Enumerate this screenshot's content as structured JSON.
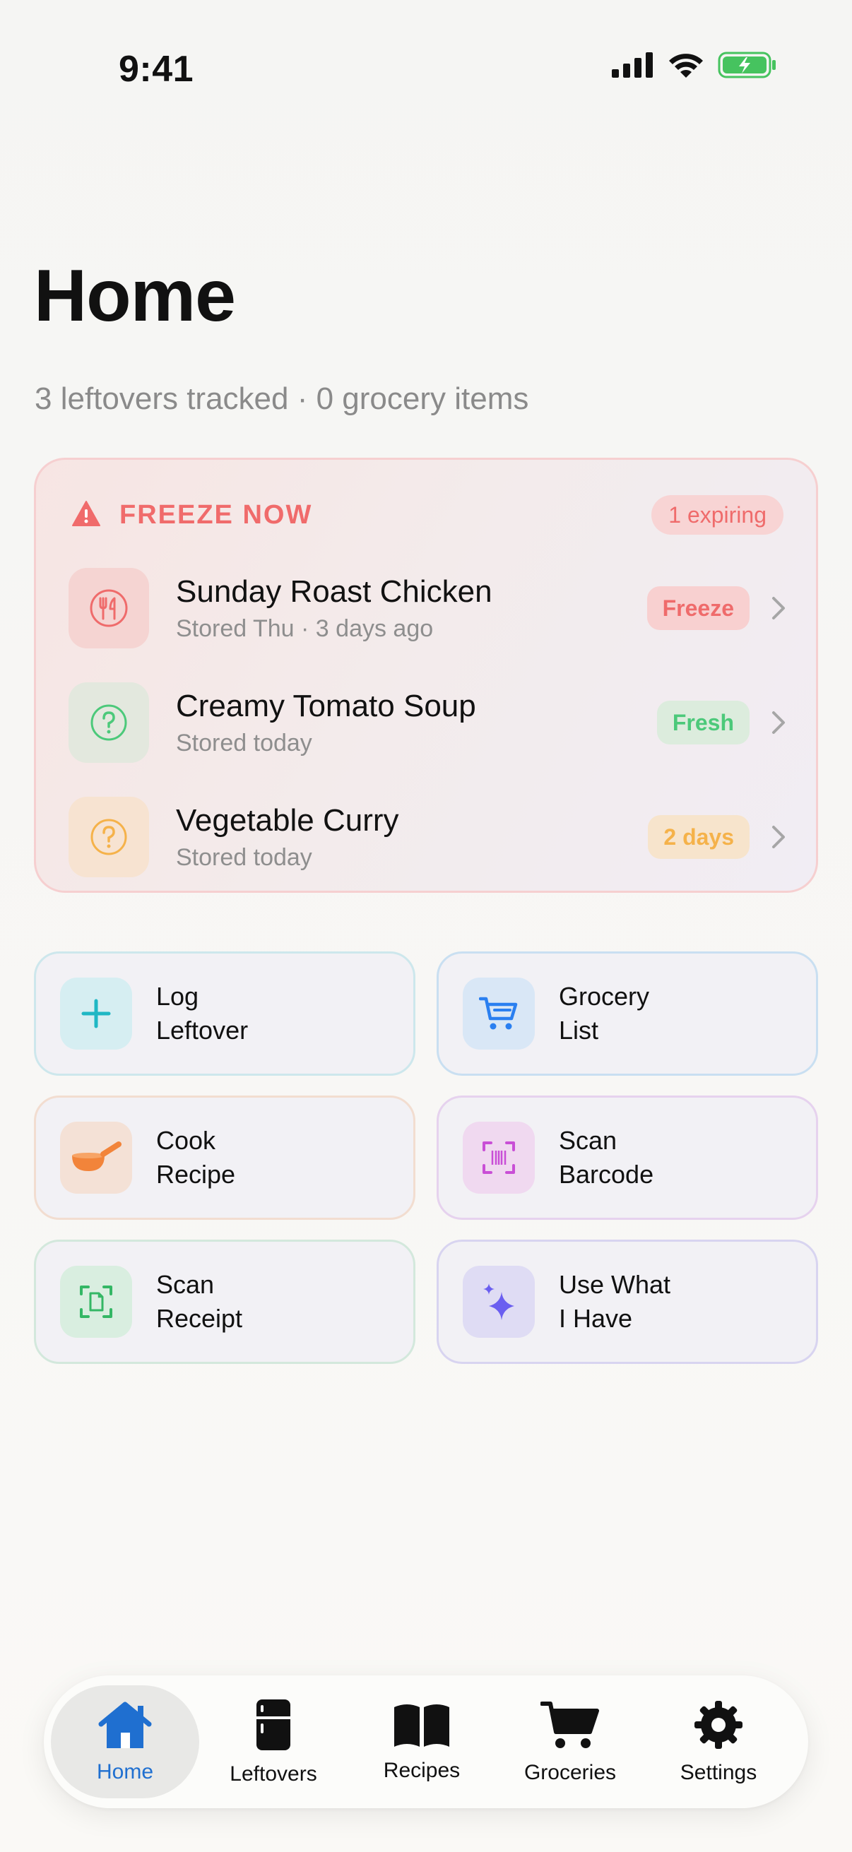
{
  "status_bar": {
    "time": "9:41"
  },
  "header": {
    "title": "Home",
    "subtitle": "3 leftovers tracked · 0 grocery items"
  },
  "freeze_card": {
    "title": "FREEZE NOW",
    "count_badge": "1 expiring",
    "items": [
      {
        "name": "Sunday Roast Chicken",
        "stored": "Stored Thu · 3 days ago",
        "badge": "Freeze",
        "icon": "utensils-icon"
      },
      {
        "name": "Creamy Tomato Soup",
        "stored": "Stored today",
        "badge": "Fresh",
        "icon": "question-icon"
      },
      {
        "name": "Vegetable Curry",
        "stored": "Stored today",
        "badge": "2 days",
        "icon": "question-icon"
      }
    ]
  },
  "actions": [
    {
      "line1": "Log",
      "line2": "Leftover",
      "icon": "plus-icon"
    },
    {
      "line1": "Grocery",
      "line2": "List",
      "icon": "cart-icon"
    },
    {
      "line1": "Cook",
      "line2": "Recipe",
      "icon": "pan-icon"
    },
    {
      "line1": "Scan",
      "line2": "Barcode",
      "icon": "barcode-scan-icon"
    },
    {
      "line1": "Scan",
      "line2": "Receipt",
      "icon": "receipt-scan-icon"
    },
    {
      "line1": "Use What",
      "line2": "I Have",
      "icon": "sparkles-icon"
    }
  ],
  "tabs": [
    {
      "label": "Home",
      "icon": "house-icon",
      "active": true
    },
    {
      "label": "Leftovers",
      "icon": "fridge-icon",
      "active": false
    },
    {
      "label": "Recipes",
      "icon": "book-icon",
      "active": false
    },
    {
      "label": "Groceries",
      "icon": "cart-icon",
      "active": false
    },
    {
      "label": "Settings",
      "icon": "gear-icon",
      "active": false
    }
  ],
  "colors": {
    "alert_red": "#ef6b6b",
    "fresh_green": "#4cc97a",
    "warn_orange": "#f5b24a",
    "tab_active_blue": "#1f6fd0"
  }
}
